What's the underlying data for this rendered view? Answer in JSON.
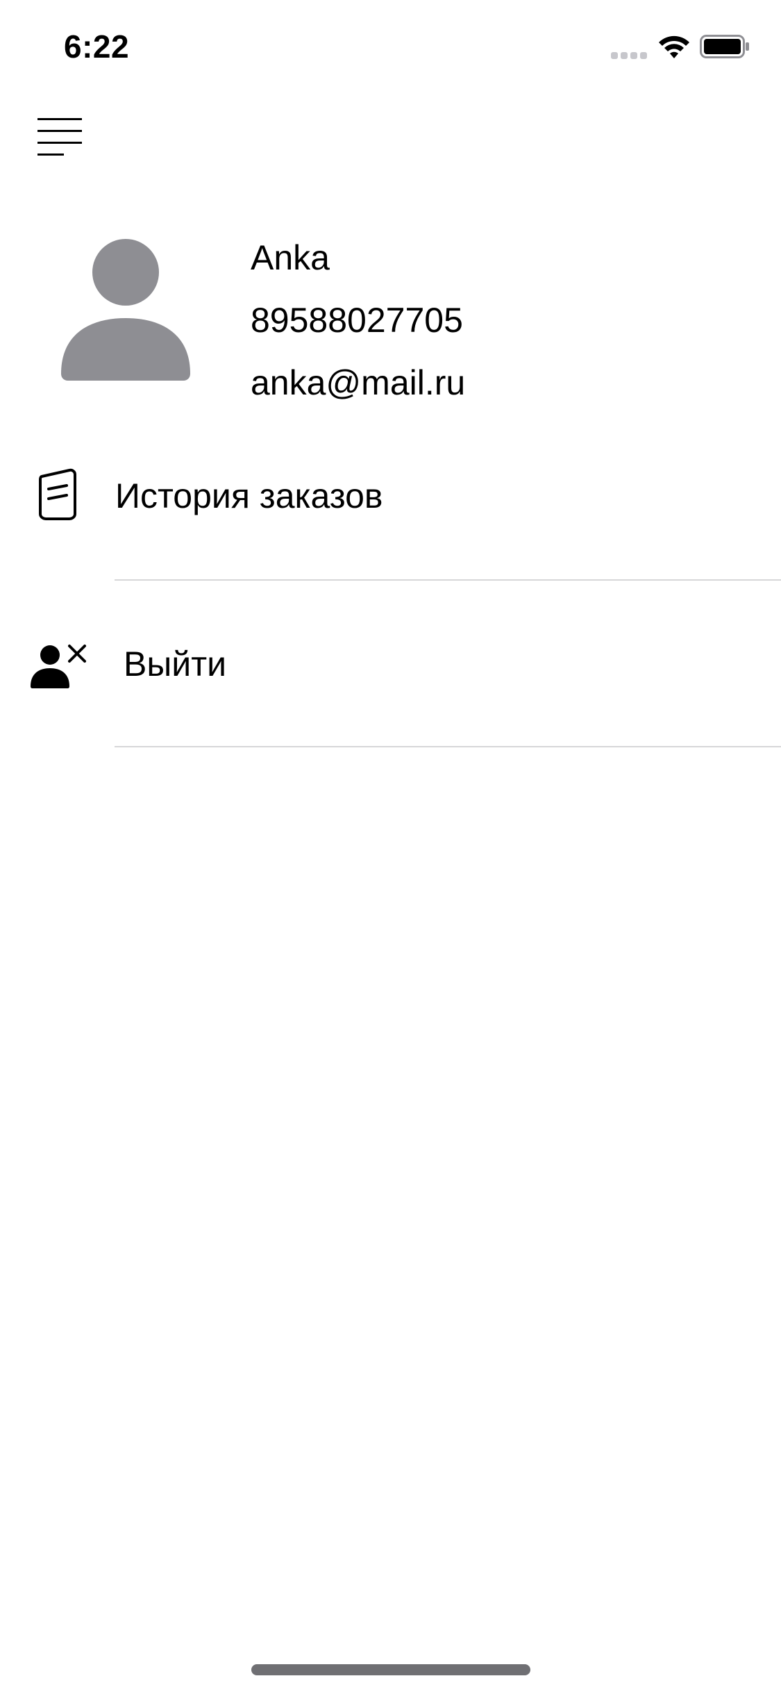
{
  "status_bar": {
    "time": "6:22"
  },
  "header": {
    "menu_icon": "hamburger-menu-icon"
  },
  "profile": {
    "avatar_icon": "person-silhouette-icon",
    "avatar_color": "#8e8e93",
    "name": "Anka",
    "phone": "89588027705",
    "email": "anka@mail.ru"
  },
  "menu": {
    "items": [
      {
        "label": "История заказов",
        "icon": "orders-history-icon"
      },
      {
        "label": "Выйти",
        "icon": "person-remove-icon"
      }
    ]
  },
  "colors": {
    "background": "#ffffff",
    "text": "#000000",
    "separator": "#d6d6d8"
  }
}
